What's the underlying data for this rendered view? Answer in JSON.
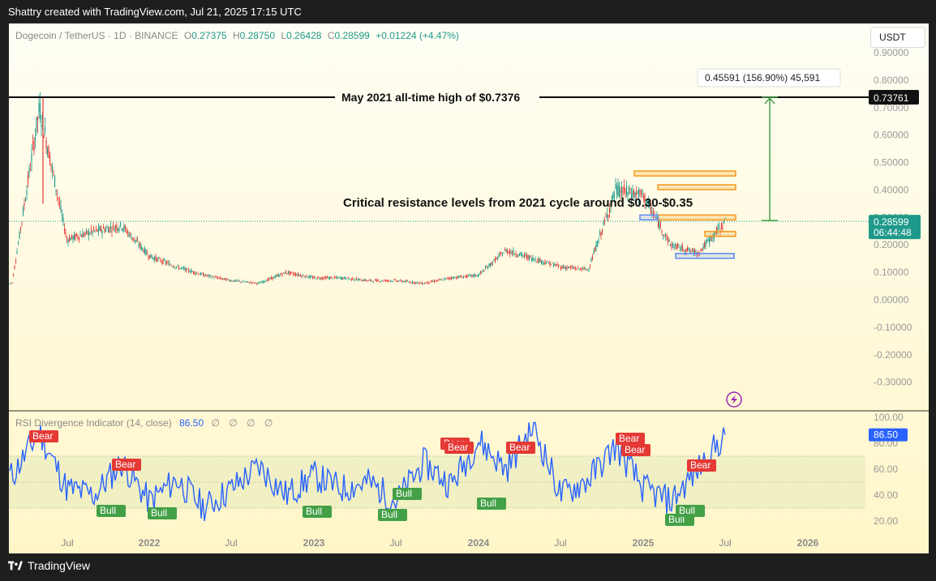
{
  "header": {
    "caption": "Shattry created with TradingView.com, Jul 21, 2025 17:15 UTC"
  },
  "legend": {
    "symbol": "Dogecoin / TetherUS · 1D · BINANCE",
    "open_label": "O",
    "open": "0.27375",
    "high_label": "H",
    "high": "0.28750",
    "low_label": "L",
    "low": "0.26428",
    "close_label": "C",
    "close": "0.28599",
    "change": "+0.01224 (+4.47%)"
  },
  "currency_button": "USDT",
  "rsi": {
    "title": "RSI Divergence Indicator (14, close)",
    "value": "86.50",
    "dots": "∅ ∅ ∅ ∅",
    "axis_ticks": [
      "100.00",
      "80.00",
      "60.00",
      "40.00",
      "20.00"
    ],
    "bear_label": "Bear",
    "bull_label": "Bull"
  },
  "footer": {
    "brand": "TradingView"
  },
  "colors": {
    "accent": "#2962ff",
    "up": "#1f9a8a",
    "down": "#e53935",
    "orange": "#f59a1a",
    "blue_box": "#5b8def",
    "green_arrow": "#43a047",
    "bull": "#43a047",
    "bear": "#e53935"
  },
  "chart_data": [
    {
      "type": "line",
      "title": "Dogecoin / TetherUS · 1D · BINANCE",
      "x_ticks": [
        "Jul",
        "2022",
        "Jul",
        "2023",
        "Jul",
        "2024",
        "Jul",
        "2025",
        "Jul",
        "2026"
      ],
      "y_ticks": [
        "0.90000",
        "0.80000",
        "0.70000",
        "0.60000",
        "0.50000",
        "0.40000",
        "0.30000",
        "0.20000",
        "0.10000",
        "0.00000",
        "-0.10000",
        "-0.20000",
        "-0.30000"
      ],
      "ylim": [
        -0.4,
        0.95
      ],
      "x": [
        "2021-03",
        "2021-05",
        "2021-07",
        "2021-09",
        "2021-11",
        "2022-01",
        "2022-03",
        "2022-05",
        "2022-07",
        "2022-09",
        "2022-11",
        "2023-01",
        "2023-03",
        "2023-05",
        "2023-07",
        "2023-09",
        "2023-11",
        "2024-01",
        "2024-03",
        "2024-05",
        "2024-07",
        "2024-09",
        "2024-11",
        "2025-01",
        "2025-03",
        "2025-05",
        "2025-07"
      ],
      "series": [
        {
          "values": [
            0.06,
            0.7,
            0.22,
            0.25,
            0.27,
            0.16,
            0.12,
            0.09,
            0.07,
            0.06,
            0.1,
            0.08,
            0.08,
            0.07,
            0.07,
            0.06,
            0.08,
            0.09,
            0.18,
            0.15,
            0.12,
            0.11,
            0.4,
            0.38,
            0.2,
            0.17,
            0.28599
          ]
        }
      ],
      "annotations": [
        {
          "text": "May 2021 all-time high of $0.7376",
          "y": 0.7376
        },
        {
          "text": "Critical resistance levels from 2021 cycle around $0.30-$0.35"
        },
        {
          "text": "0.45591 (156.90%) 45,591"
        }
      ],
      "price_label": "0.73761",
      "last_price": "0.28599",
      "countdown": "06:44:48",
      "resistance_zones": [
        0.46,
        0.41,
        0.3,
        0.24
      ],
      "support_zones": [
        0.3,
        0.16
      ]
    },
    {
      "type": "line",
      "title": "RSI Divergence Indicator (14, close)",
      "ylim": [
        10,
        100
      ],
      "x": [
        "2021-03",
        "2021-05",
        "2021-07",
        "2021-09",
        "2021-11",
        "2022-01",
        "2022-03",
        "2022-05",
        "2022-07",
        "2022-09",
        "2022-11",
        "2023-01",
        "2023-03",
        "2023-05",
        "2023-07",
        "2023-09",
        "2023-11",
        "2024-01",
        "2024-03",
        "2024-05",
        "2024-07",
        "2024-09",
        "2024-11",
        "2025-01",
        "2025-03",
        "2025-05",
        "2025-07"
      ],
      "series": [
        {
          "values": [
            55,
            88,
            45,
            40,
            65,
            35,
            52,
            30,
            45,
            62,
            40,
            55,
            45,
            50,
            35,
            65,
            48,
            82,
            60,
            93,
            40,
            52,
            78,
            45,
            35,
            60,
            86.5
          ]
        }
      ]
    }
  ]
}
